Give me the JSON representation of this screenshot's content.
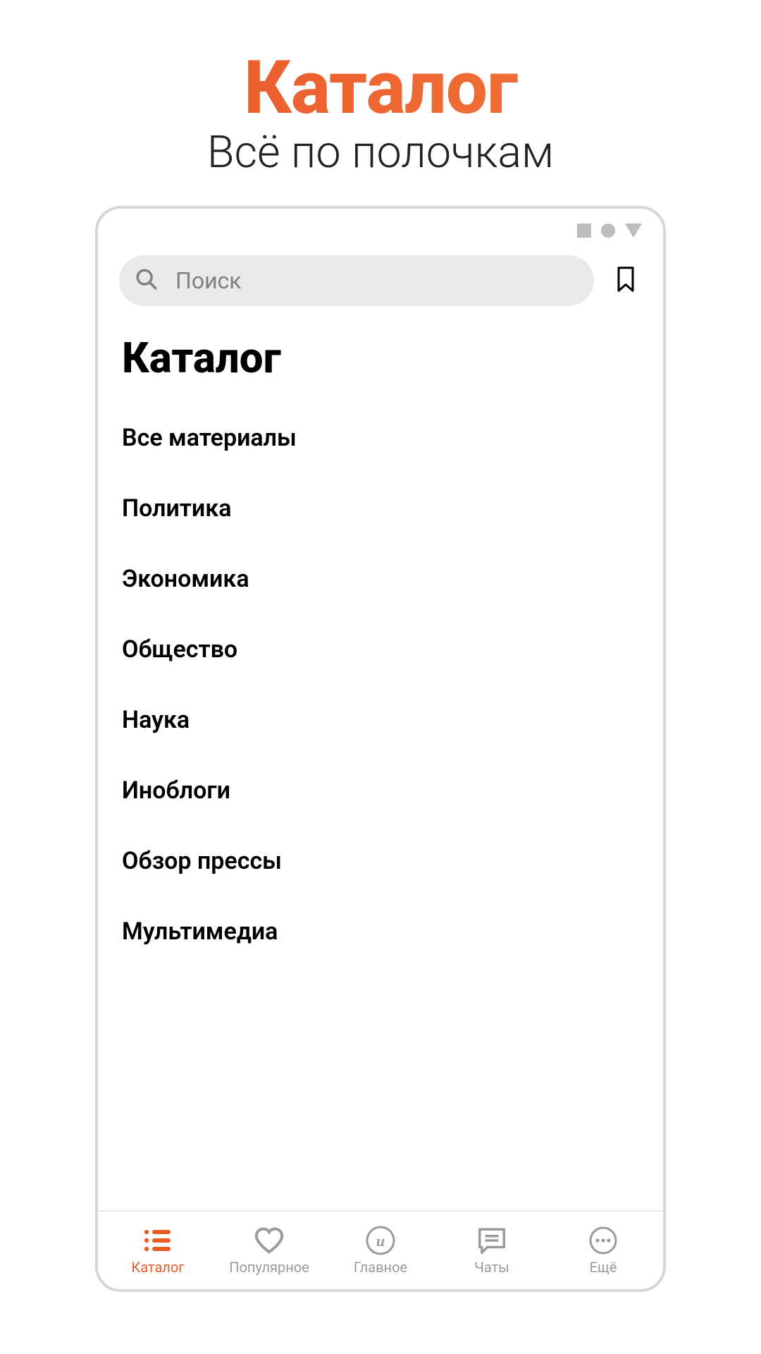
{
  "promo": {
    "title": "Каталог",
    "subtitle": "Всё по полочкам"
  },
  "search": {
    "placeholder": "Поиск"
  },
  "page": {
    "title": "Каталог"
  },
  "categories": [
    "Все материалы",
    "Политика",
    "Экономика",
    "Общество",
    "Наука",
    "Иноблоги",
    "Обзор прессы",
    "Мультимедиа"
  ],
  "nav": {
    "items": [
      {
        "label": "Каталог"
      },
      {
        "label": "Популярное"
      },
      {
        "label": "Главное"
      },
      {
        "label": "Чаты"
      },
      {
        "label": "Ещё"
      }
    ],
    "active_index": 0
  },
  "colors": {
    "accent": "#ec5b24",
    "muted": "#9a9a9a"
  }
}
